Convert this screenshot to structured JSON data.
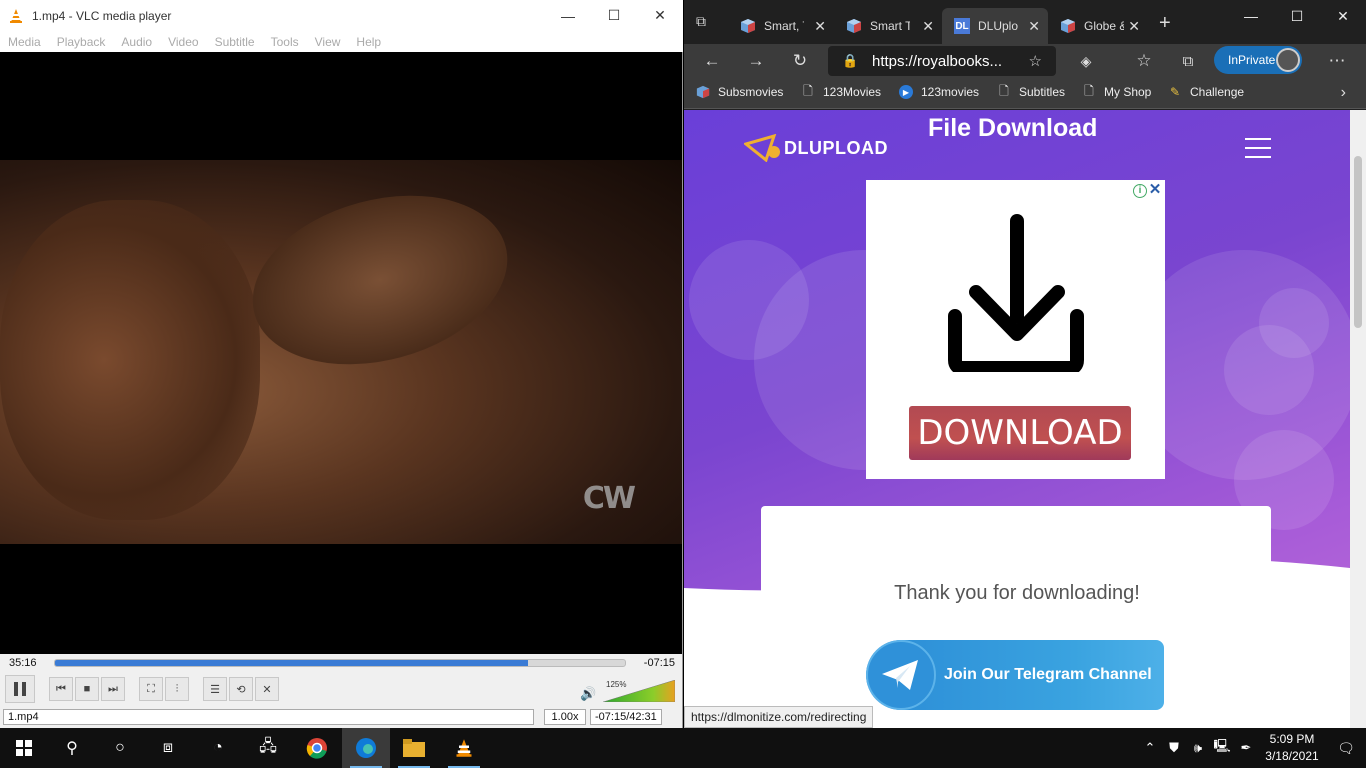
{
  "vlc": {
    "title": "1.mp4 - VLC media player",
    "menu": [
      "Media",
      "Playback",
      "Audio",
      "Video",
      "Subtitle",
      "Tools",
      "View",
      "Help"
    ],
    "watermark": "CW",
    "elapsed": "35:16",
    "remaining": "-07:15",
    "progress": 0.83,
    "volume_pct": "125%",
    "status_file": "1.mp4",
    "status_speed": "1.00x",
    "status_time": "-07:15/42:31",
    "minimize": "—",
    "maximize": "☐",
    "close": "✕"
  },
  "edge": {
    "tabs": [
      {
        "label": "Smart, T",
        "icon": "cube-icon"
      },
      {
        "label": "Smart T",
        "icon": "cube-icon"
      },
      {
        "label": "DLUplo",
        "icon": "dl-icon",
        "fav": "DL"
      },
      {
        "label": "Globe &",
        "icon": "cube-icon"
      }
    ],
    "url": "https://royalbooks...",
    "inprivate": "InPrivate",
    "bookmarks": [
      "Subsmovies",
      "123Movies",
      "123movies",
      "Subtitles",
      "My Shop",
      "Challenge"
    ],
    "status_url": "https://dlmonitize.com/redirecting"
  },
  "page": {
    "logo_text": "DLUPLOAD",
    "title": "File Download",
    "ad_button": "DOWNLOAD",
    "ad_info": "i",
    "ad_close": "✕",
    "thanks": "Thank you for downloading!",
    "telegram": "Join Our Telegram Channel"
  },
  "taskbar": {
    "time": "5:09 PM",
    "date": "3/18/2021"
  },
  "colors": {
    "vlc_seek": "#3a7bd5",
    "edge_inprivate": "#1a6fb7",
    "page_bg_start": "#6a3fd8",
    "page_bg_end": "#c070d8",
    "telegram": "#2b8cd6"
  }
}
